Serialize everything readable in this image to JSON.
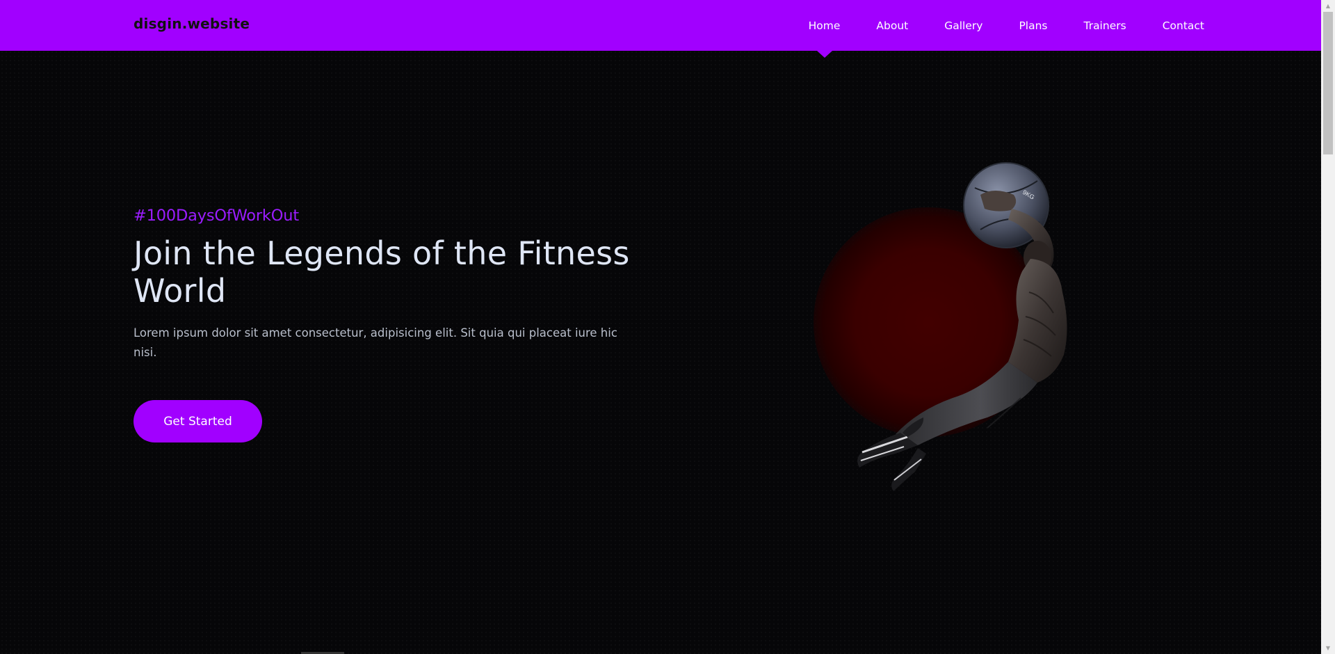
{
  "logo": {
    "main": "disgin",
    "ext": ".website"
  },
  "nav": {
    "items": [
      {
        "label": "Home",
        "active": true
      },
      {
        "label": "About",
        "active": false
      },
      {
        "label": "Gallery",
        "active": false
      },
      {
        "label": "Plans",
        "active": false
      },
      {
        "label": "Trainers",
        "active": false
      },
      {
        "label": "Contact",
        "active": false
      }
    ]
  },
  "hero": {
    "hashtag": "#100DaysOfWorkOut",
    "title": "Join the Legends of the Fitness World",
    "description": "Lorem ipsum dolor sit amet consectetur, adipisicing elit. Sit quia qui placeat iure hic nisi.",
    "cta_label": "Get Started",
    "image_label": "athlete-with-medicine-ball-image"
  },
  "colors": {
    "accent": "#a100ff",
    "background": "#060608",
    "title_text": "#dfe6f5",
    "body_text": "#b9bfcc",
    "glow": "#3a0000"
  }
}
